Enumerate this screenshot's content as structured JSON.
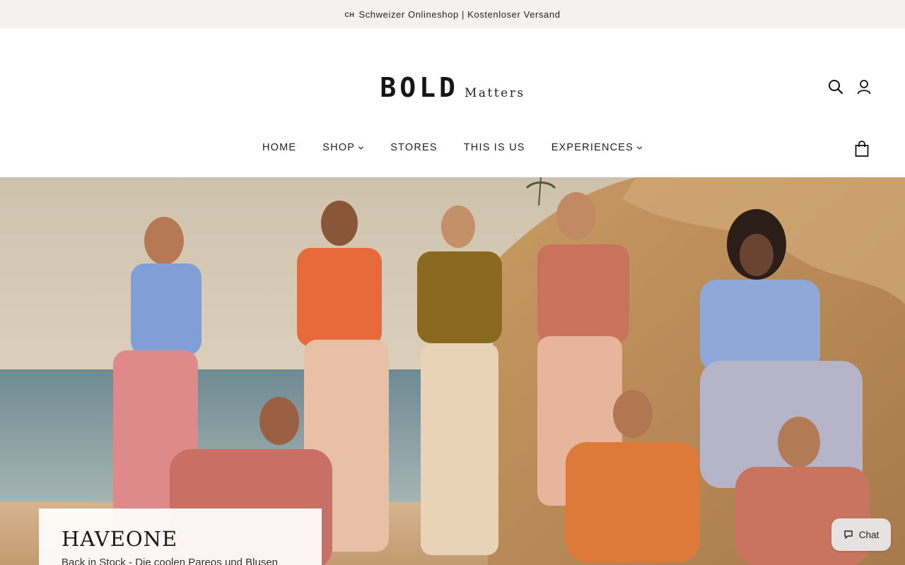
{
  "announcement": {
    "flag": "CH",
    "text": "Schweizer Onlineshop | Kostenloser Versand"
  },
  "logo": {
    "bold": "BOLD",
    "matters": "Matters"
  },
  "header_icons": [
    "search-icon",
    "account-icon"
  ],
  "nav": {
    "items": [
      {
        "label": "HOME",
        "dropdown": false
      },
      {
        "label": "SHOP",
        "dropdown": true
      },
      {
        "label": "STORES",
        "dropdown": false
      },
      {
        "label": "THIS IS US",
        "dropdown": false
      },
      {
        "label": "EXPERIENCES",
        "dropdown": true
      }
    ],
    "cart_icon": "shopping-bag-icon"
  },
  "hero": {
    "title": "HAVEONE",
    "subtitle": "Back in Stock - Die coolen Pareos und Blusen"
  },
  "chat": {
    "label": "Chat",
    "icon": "chat-bubble-icon"
  },
  "colors": {
    "announcement_bg": "#f6f1f1",
    "text": "#1a1a1a",
    "chat_bg": "#e6e2e2"
  }
}
